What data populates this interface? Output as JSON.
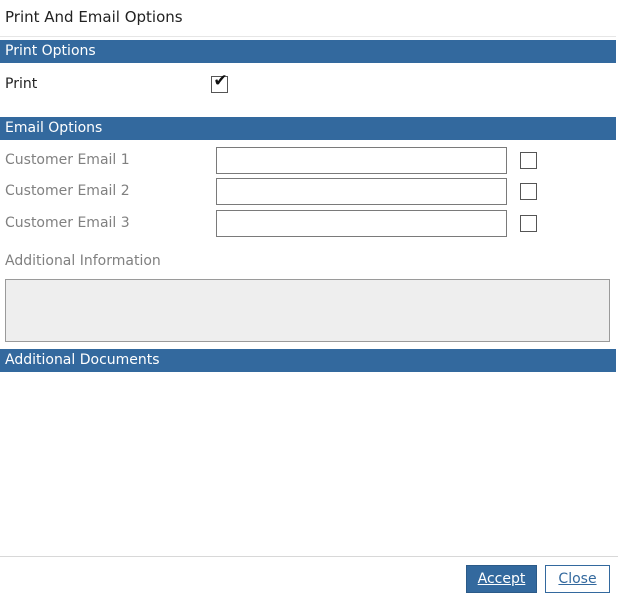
{
  "dialog": {
    "title": "Print And Email Options"
  },
  "print_section": {
    "header": "Print Options",
    "print_label": "Print",
    "print_checked": true
  },
  "email_section": {
    "header": "Email Options",
    "emails": [
      {
        "label": "Customer Email 1",
        "value": "",
        "checked": false
      },
      {
        "label": "Customer Email 2",
        "value": "",
        "checked": false
      },
      {
        "label": "Customer Email 3",
        "value": "",
        "checked": false
      }
    ],
    "additional_info_label": "Additional Information",
    "additional_info_value": ""
  },
  "documents_section": {
    "header": "Additional Documents"
  },
  "footer": {
    "accept_label": "Accept",
    "close_label": "Close"
  },
  "colors": {
    "accent": "#33699e"
  }
}
